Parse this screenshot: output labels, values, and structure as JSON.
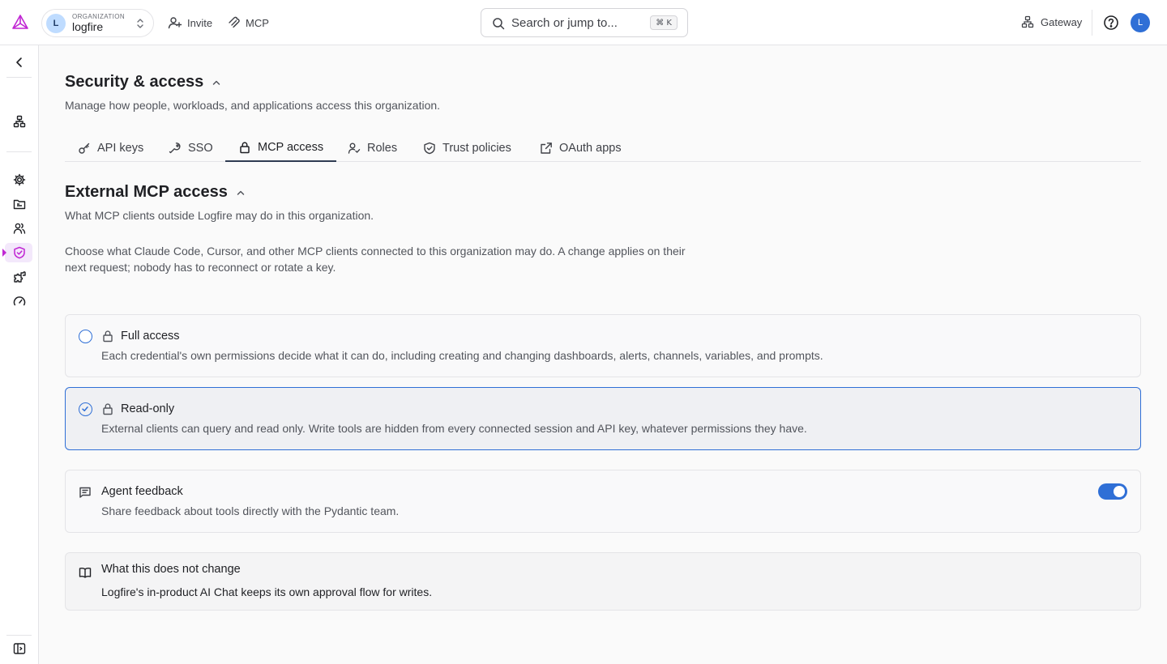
{
  "topbar": {
    "org_caption": "ORGANIZATION",
    "org_name": "logfire",
    "org_initial": "L",
    "invite_label": "Invite",
    "mcp_label": "MCP",
    "search_placeholder": "Search or jump to...",
    "search_shortcut": "⌘ K",
    "gateway_label": "Gateway",
    "user_initial": "L"
  },
  "sidebar": {
    "items": [
      {
        "name": "collapse-sidebar",
        "icon": "chevron-left-icon"
      },
      {
        "name": "projects",
        "icon": "sitemap-icon"
      },
      {
        "name": "settings",
        "icon": "gear-icon"
      },
      {
        "name": "folders",
        "icon": "folder-icon"
      },
      {
        "name": "members",
        "icon": "users-icon"
      },
      {
        "name": "security",
        "icon": "shield-check-icon",
        "active": true
      },
      {
        "name": "integrations",
        "icon": "puzzle-icon"
      },
      {
        "name": "usage",
        "icon": "gauge-icon"
      },
      {
        "name": "expand-panel",
        "icon": "sidebar-panel-icon"
      }
    ]
  },
  "page": {
    "title": "Security & access",
    "subtitle": "Manage how people, workloads, and applications access this organization."
  },
  "tabs": [
    {
      "label": "API keys",
      "icon": "key-icon"
    },
    {
      "label": "SSO",
      "icon": "wrench-key-icon"
    },
    {
      "label": "MCP access",
      "icon": "lock-icon",
      "active": true
    },
    {
      "label": "Roles",
      "icon": "user-check-icon"
    },
    {
      "label": "Trust policies",
      "icon": "shield-icon"
    },
    {
      "label": "OAuth apps",
      "icon": "external-link-icon"
    }
  ],
  "section": {
    "title": "External MCP access",
    "subtitle": "What MCP clients outside Logfire may do in this organization.",
    "description": "Choose what Claude Code, Cursor, and other MCP clients connected to this organization may do. A change applies on their next request; nobody has to reconnect or rotate a key."
  },
  "options": [
    {
      "title": "Full access",
      "description": "Each credential's own permissions decide what it can do, including creating and changing dashboards, alerts, channels, variables, and prompts.",
      "selected": false
    },
    {
      "title": "Read-only",
      "description": "External clients can query and read only. Write tools are hidden from every connected session and API key, whatever permissions they have.",
      "selected": true
    }
  ],
  "feedback": {
    "title": "Agent feedback",
    "description": "Share feedback about tools directly with the Pydantic team.",
    "enabled": true
  },
  "note": {
    "title": "What this does not change",
    "description": "Logfire's in-product AI Chat keeps its own approval flow for writes."
  },
  "colors": {
    "accent": "#2f6fd6",
    "brand": "#c026d3",
    "active_sidebar_bg": "#f3e8fb"
  }
}
